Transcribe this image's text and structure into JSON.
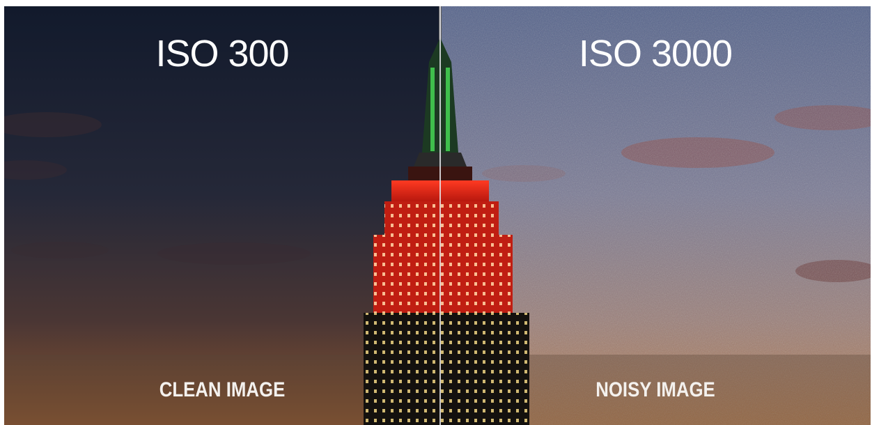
{
  "left": {
    "label": "ISO 300",
    "caption": "CLEAN IMAGE"
  },
  "right": {
    "label": "ISO 3000",
    "caption": "NOISY IMAGE"
  },
  "colors": {
    "left_sky_top": "#121a2c",
    "left_sky_mid": "#2a2a3a",
    "left_sky_bottom": "#7a4a2c",
    "right_sky_top": "#5a6a94",
    "right_sky_mid": "#7d7b92",
    "right_sky_bottom": "#b07a50",
    "building_red": "#e0281a",
    "spire_green": "#3fbf4c",
    "window_light": "#f4d98a",
    "caption_text": "#f4f1ee"
  }
}
